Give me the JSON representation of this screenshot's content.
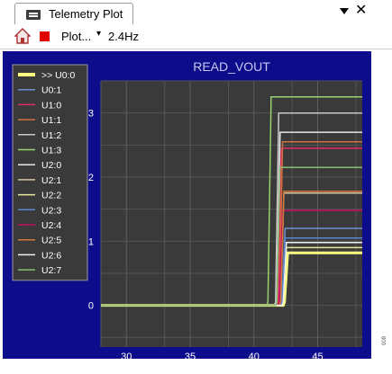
{
  "window": {
    "tab_title": "Telemetry Plot",
    "dropdown_icon": "chevron-down-icon",
    "close_symbol": "✕"
  },
  "toolbar": {
    "home_icon": "home-icon",
    "stop_icon": "stop-icon",
    "plot_label": "Plot...",
    "plot_dropdown": "▾",
    "rate": "2.4Hz"
  },
  "side_text": "008",
  "colors": {
    "plot_bg": "#0d0d8c",
    "chart_bg": "#3a3a3a",
    "grid": "#555555"
  },
  "chart_data": {
    "type": "line",
    "title": "READ_VOUT",
    "xlim": [
      28,
      48.5
    ],
    "ylim": [
      -0.65,
      3.5
    ],
    "xticks": [
      30,
      35,
      40,
      45
    ],
    "yticks": [
      0,
      1,
      2,
      3
    ],
    "grid": true,
    "legend_position": "top-left",
    "series": [
      {
        "name": ">> U0:0",
        "color": "#ffff80",
        "step_x": 42.3,
        "final": 0.82,
        "highlight": true
      },
      {
        "name": "U0:1",
        "color": "#6f8fd0",
        "step_x": 42.1,
        "final": 1.2
      },
      {
        "name": "U1:0",
        "color": "#e02d62",
        "step_x": 41.8,
        "final": 2.45
      },
      {
        "name": "U1:1",
        "color": "#d07040",
        "step_x": 41.9,
        "final": 2.55
      },
      {
        "name": "U1:2",
        "color": "#c8c8c8",
        "step_x": 41.6,
        "final": 3.0
      },
      {
        "name": "U1:3",
        "color": "#9bd16e",
        "step_x": 41.0,
        "final": 3.25
      },
      {
        "name": "U2:0",
        "color": "#e8e8e8",
        "step_x": 41.7,
        "final": 2.7
      },
      {
        "name": "U2:1",
        "color": "#d5c4a0",
        "step_x": 42.0,
        "final": 1.75
      },
      {
        "name": "U2:2",
        "color": "#e8e89a",
        "step_x": 42.2,
        "final": 0.9
      },
      {
        "name": "U2:3",
        "color": "#5a86d0",
        "step_x": 42.1,
        "final": 1.05
      },
      {
        "name": "U2:4",
        "color": "#c01060",
        "step_x": 41.9,
        "final": 1.48
      },
      {
        "name": "U2:5",
        "color": "#d0783a",
        "step_x": 42.0,
        "final": 1.78
      },
      {
        "name": "U2:6",
        "color": "#f0f0f0",
        "step_x": 42.2,
        "final": 0.98
      },
      {
        "name": "U2:7",
        "color": "#88c070",
        "step_x": 41.7,
        "final": 2.15
      }
    ]
  }
}
